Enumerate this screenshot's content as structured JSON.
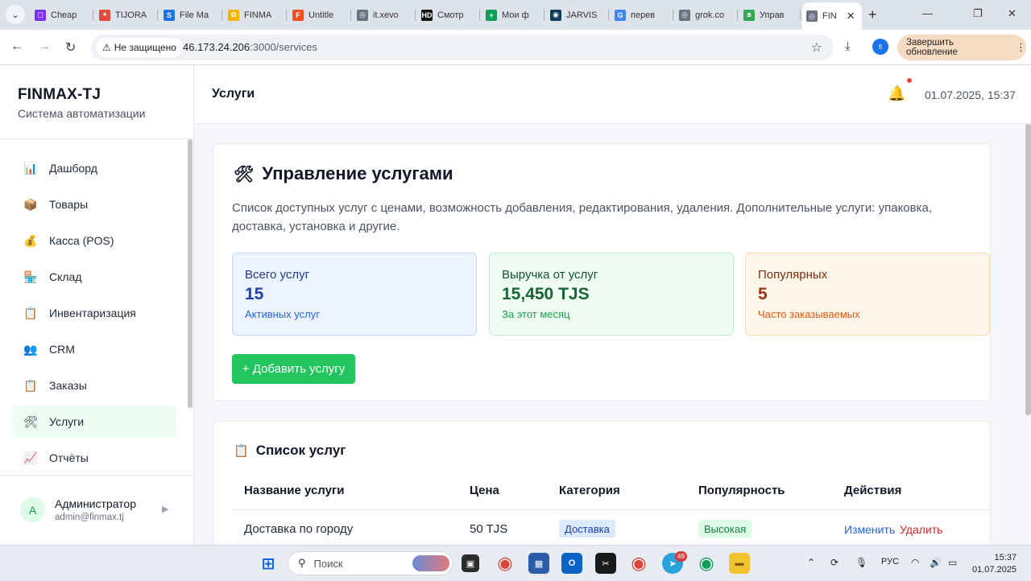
{
  "browser": {
    "tabs": [
      {
        "label": "Cheap",
        "color": "#7b2ff7",
        "glyph": "◻"
      },
      {
        "label": "TIJORA",
        "color": "#e54b3c",
        "glyph": "✦"
      },
      {
        "label": "File Ma",
        "color": "#1a73e8",
        "glyph": "S"
      },
      {
        "label": "FINMA",
        "color": "#f4b400",
        "glyph": "✿"
      },
      {
        "label": "Untitle",
        "color": "#f24e1e",
        "glyph": "F"
      },
      {
        "label": "it.xevo",
        "color": "#6b7280",
        "glyph": "◎"
      },
      {
        "label": "Смотр",
        "color": "#111111",
        "glyph": "HD"
      },
      {
        "label": "Мои ф",
        "color": "#0f9d58",
        "glyph": "+"
      },
      {
        "label": "JARVIS",
        "color": "#0b3d5c",
        "glyph": "◉"
      },
      {
        "label": "перев",
        "color": "#4285f4",
        "glyph": "G"
      },
      {
        "label": "grok.co",
        "color": "#6b7280",
        "glyph": "◎"
      },
      {
        "label": "Управ",
        "color": "#34a853",
        "glyph": "ꞩ"
      },
      {
        "label": "FIN",
        "color": "#6b7280",
        "glyph": "◎"
      }
    ],
    "security_label": "Не защищено",
    "url_host": "46.173.24.206",
    "url_path": ":3000/services",
    "update_label": "Завершить обновление",
    "profile_initials": "fi"
  },
  "sidebar": {
    "brand": "FINMAX-TJ",
    "subtitle": "Система автоматизации",
    "items": [
      {
        "label": "Дашборд",
        "icon": "📊"
      },
      {
        "label": "Товары",
        "icon": "📦"
      },
      {
        "label": "Касса (POS)",
        "icon": "💰"
      },
      {
        "label": "Склад",
        "icon": "🏪"
      },
      {
        "label": "Инвентаризация",
        "icon": "📋"
      },
      {
        "label": "CRM",
        "icon": "👥"
      },
      {
        "label": "Заказы",
        "icon": "📋"
      },
      {
        "label": "Услуги",
        "icon": "🛠"
      },
      {
        "label": "Отчёты",
        "icon": "📈"
      }
    ],
    "active_index": 7,
    "user": {
      "initial": "A",
      "name": "Администратор",
      "email": "admin@finmax.tj"
    }
  },
  "header": {
    "title": "Услуги",
    "datetime": "01.07.2025, 15:37"
  },
  "services_card": {
    "icon": "🛠",
    "title": "Управление услугами",
    "description": "Список доступных услуг с ценами, возможность добавления, редактирования, удаления. Дополнительные услуги: упаковка, доставка, установка и другие.",
    "stats": [
      {
        "label": "Всего услуг",
        "value": "15",
        "sub": "Активных услуг"
      },
      {
        "label": "Выручка от услуг",
        "value": "15,450 TJS",
        "sub": "За этот месяц"
      },
      {
        "label": "Популярных",
        "value": "5",
        "sub": "Часто заказываемых"
      }
    ],
    "add_button": "+ Добавить услугу"
  },
  "services_list": {
    "icon": "📋",
    "title": "Список услуг",
    "columns": [
      "Название услуги",
      "Цена",
      "Категория",
      "Популярность",
      "Действия"
    ],
    "rows": [
      {
        "name": "Доставка по городу",
        "price": "50 TJS",
        "category": "Доставка",
        "popularity": "Высокая",
        "edit": "Изменить",
        "delete": "Удалить"
      }
    ]
  },
  "taskbar": {
    "search_placeholder": "Поиск",
    "lang": "РУС",
    "time": "15:37",
    "date": "01.07.2025",
    "telegram_badge": "49"
  }
}
